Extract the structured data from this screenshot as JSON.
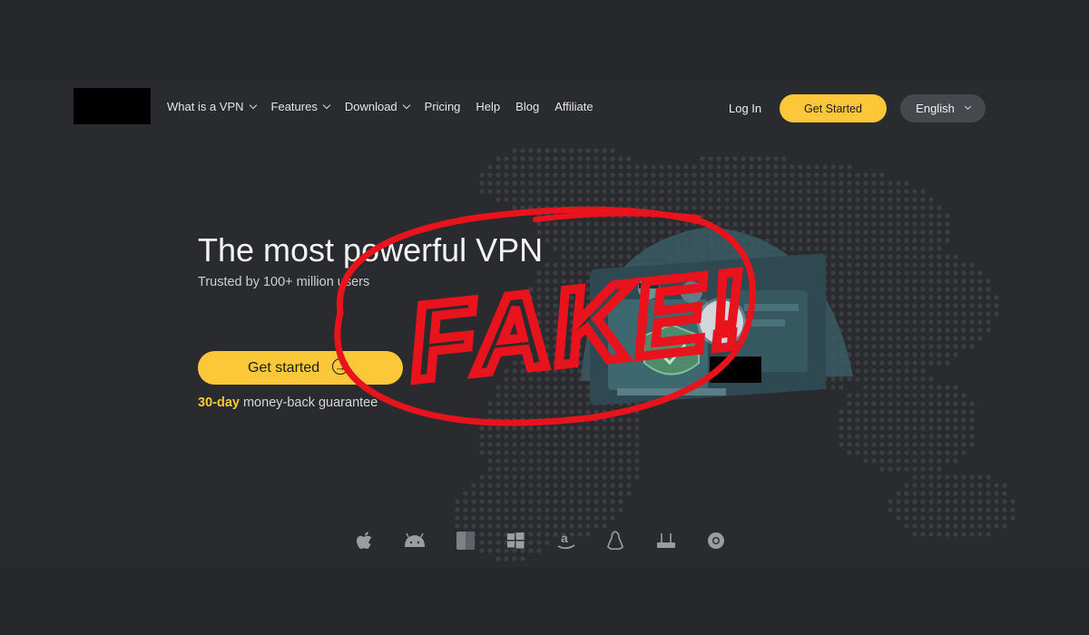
{
  "header": {
    "nav": [
      {
        "label": "What is a VPN",
        "has_dropdown": true
      },
      {
        "label": "Features",
        "has_dropdown": true
      },
      {
        "label": "Download",
        "has_dropdown": true
      },
      {
        "label": "Pricing",
        "has_dropdown": false
      },
      {
        "label": "Help",
        "has_dropdown": false
      },
      {
        "label": "Blog",
        "has_dropdown": false
      },
      {
        "label": "Affiliate",
        "has_dropdown": false
      }
    ],
    "login_label": "Log In",
    "get_started_label": "Get Started",
    "language": "English"
  },
  "hero": {
    "title": "The most powerful VPN",
    "subtitle": "Trusted by 100+ million users",
    "cta_label": "Get started",
    "guarantee_highlight": "30-day",
    "guarantee_rest": " money-back guarantee"
  },
  "overlay": {
    "stamp_text": "FAKE!",
    "stamp_color": "#e8131c"
  },
  "platforms": [
    "apple-icon",
    "android-icon",
    "finder-icon",
    "windows-icon",
    "amazon-icon",
    "linux-icon",
    "router-icon",
    "chrome-icon"
  ],
  "colors": {
    "accent": "#fdc73a",
    "background": "#2a2b2e"
  }
}
